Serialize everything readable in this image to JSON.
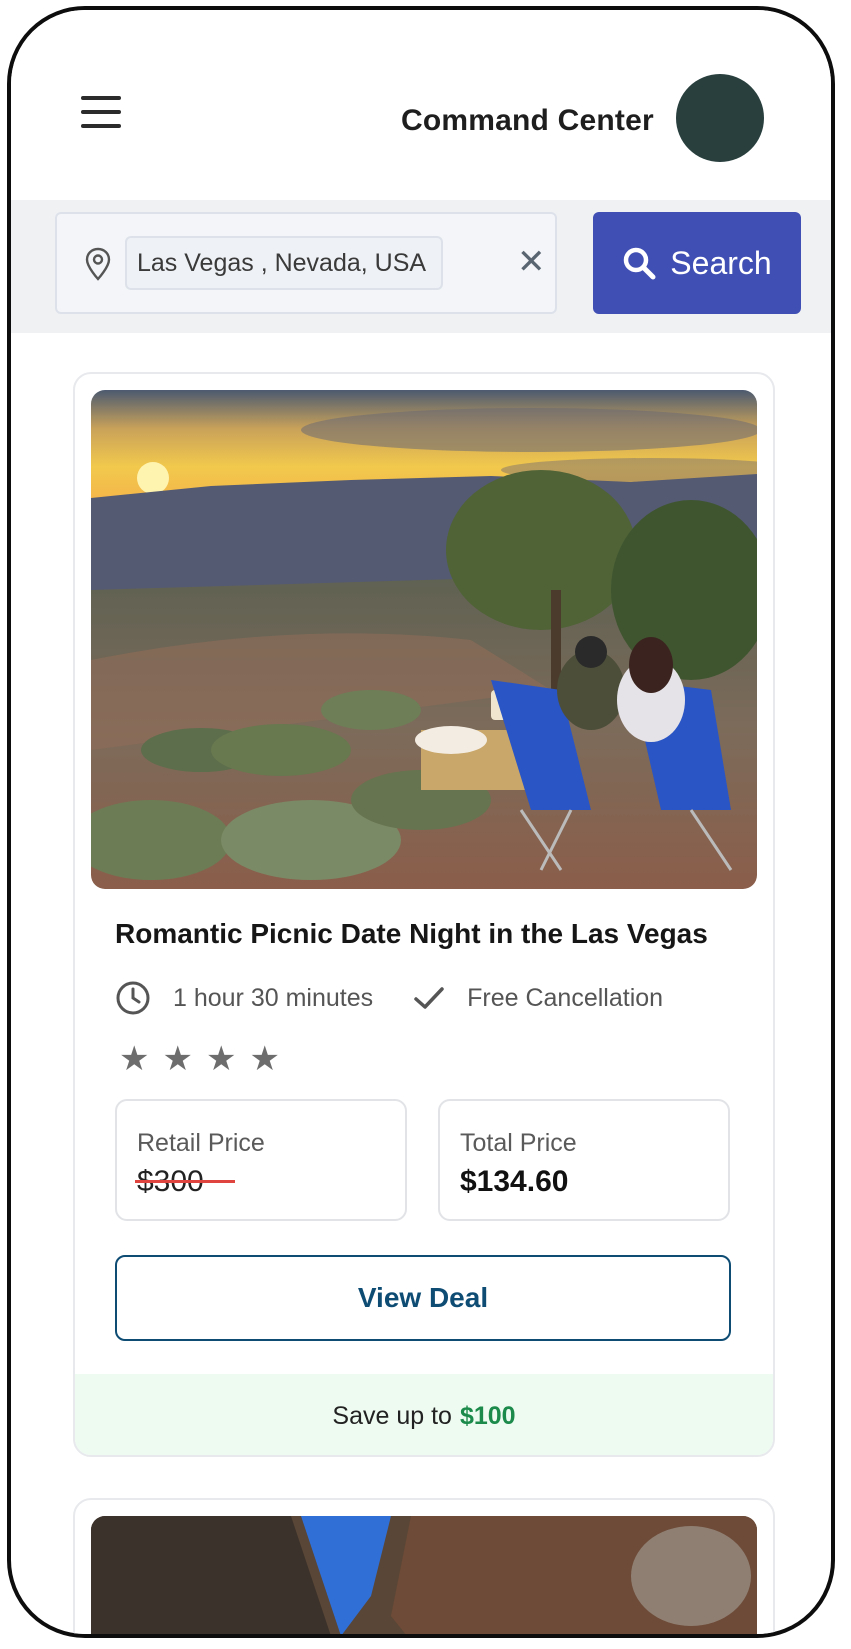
{
  "header": {
    "title": "Command Center",
    "menu_icon": "hamburger-menu-icon",
    "avatar_color": "#283f3e"
  },
  "search": {
    "location_value": "Las Vegas , Nevada, USA",
    "pin_icon": "map-pin-icon",
    "clear_icon": "close-icon",
    "clear_glyph": "✕",
    "button_label": "Search",
    "button_color": "#3f4fb4"
  },
  "deal": {
    "title": "Romantic Picnic Date Night in the Las Vegas",
    "duration": "1 hour 30 minutes",
    "cancellation": "Free Cancellation",
    "rating_stars": 4,
    "star_glyphs": [
      "★",
      "★",
      "★",
      "★"
    ],
    "retail_label": "Retail Price",
    "retail_value": "$300",
    "total_label": "Total Price",
    "total_value": "$134.60",
    "cta_label": "View Deal",
    "save_text": "Save up to",
    "save_amount": "$100",
    "save_color": "#1b8a4a"
  }
}
